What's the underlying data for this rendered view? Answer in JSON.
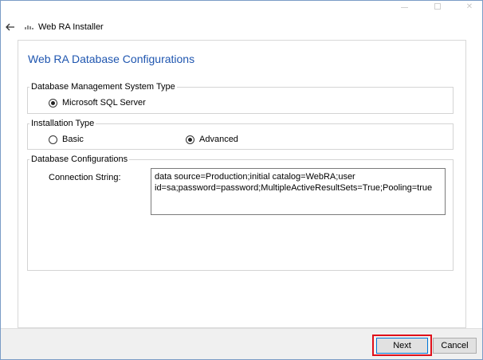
{
  "window": {
    "title": "Web RA  Installer",
    "controls": [
      "minimize",
      "maximize",
      "close"
    ],
    "close_glyph": "✕"
  },
  "page": {
    "title": "Web RA Database Configurations"
  },
  "dbms_group": {
    "legend": "Database Management System Type",
    "options": [
      {
        "label": "Microsoft SQL Server",
        "selected": true
      }
    ]
  },
  "install_group": {
    "legend": "Installation Type",
    "options": [
      {
        "label": "Basic",
        "selected": false
      },
      {
        "label": "Advanced",
        "selected": true
      }
    ]
  },
  "dbconf_group": {
    "legend": "Database Configurations",
    "connection_label": "Connection String:",
    "connection_value": "data source=Production;initial catalog=WebRA;user id=sa;password=password;MultipleActiveResultSets=True;Pooling=true"
  },
  "footer": {
    "next_label": "Next",
    "cancel_label": "Cancel"
  },
  "colors": {
    "title_blue": "#1f56b0",
    "highlight_red": "#e0101a",
    "default_button_border": "#0078d7"
  },
  "icons": {
    "back": "arrow-left-icon",
    "app": "app-icon"
  }
}
